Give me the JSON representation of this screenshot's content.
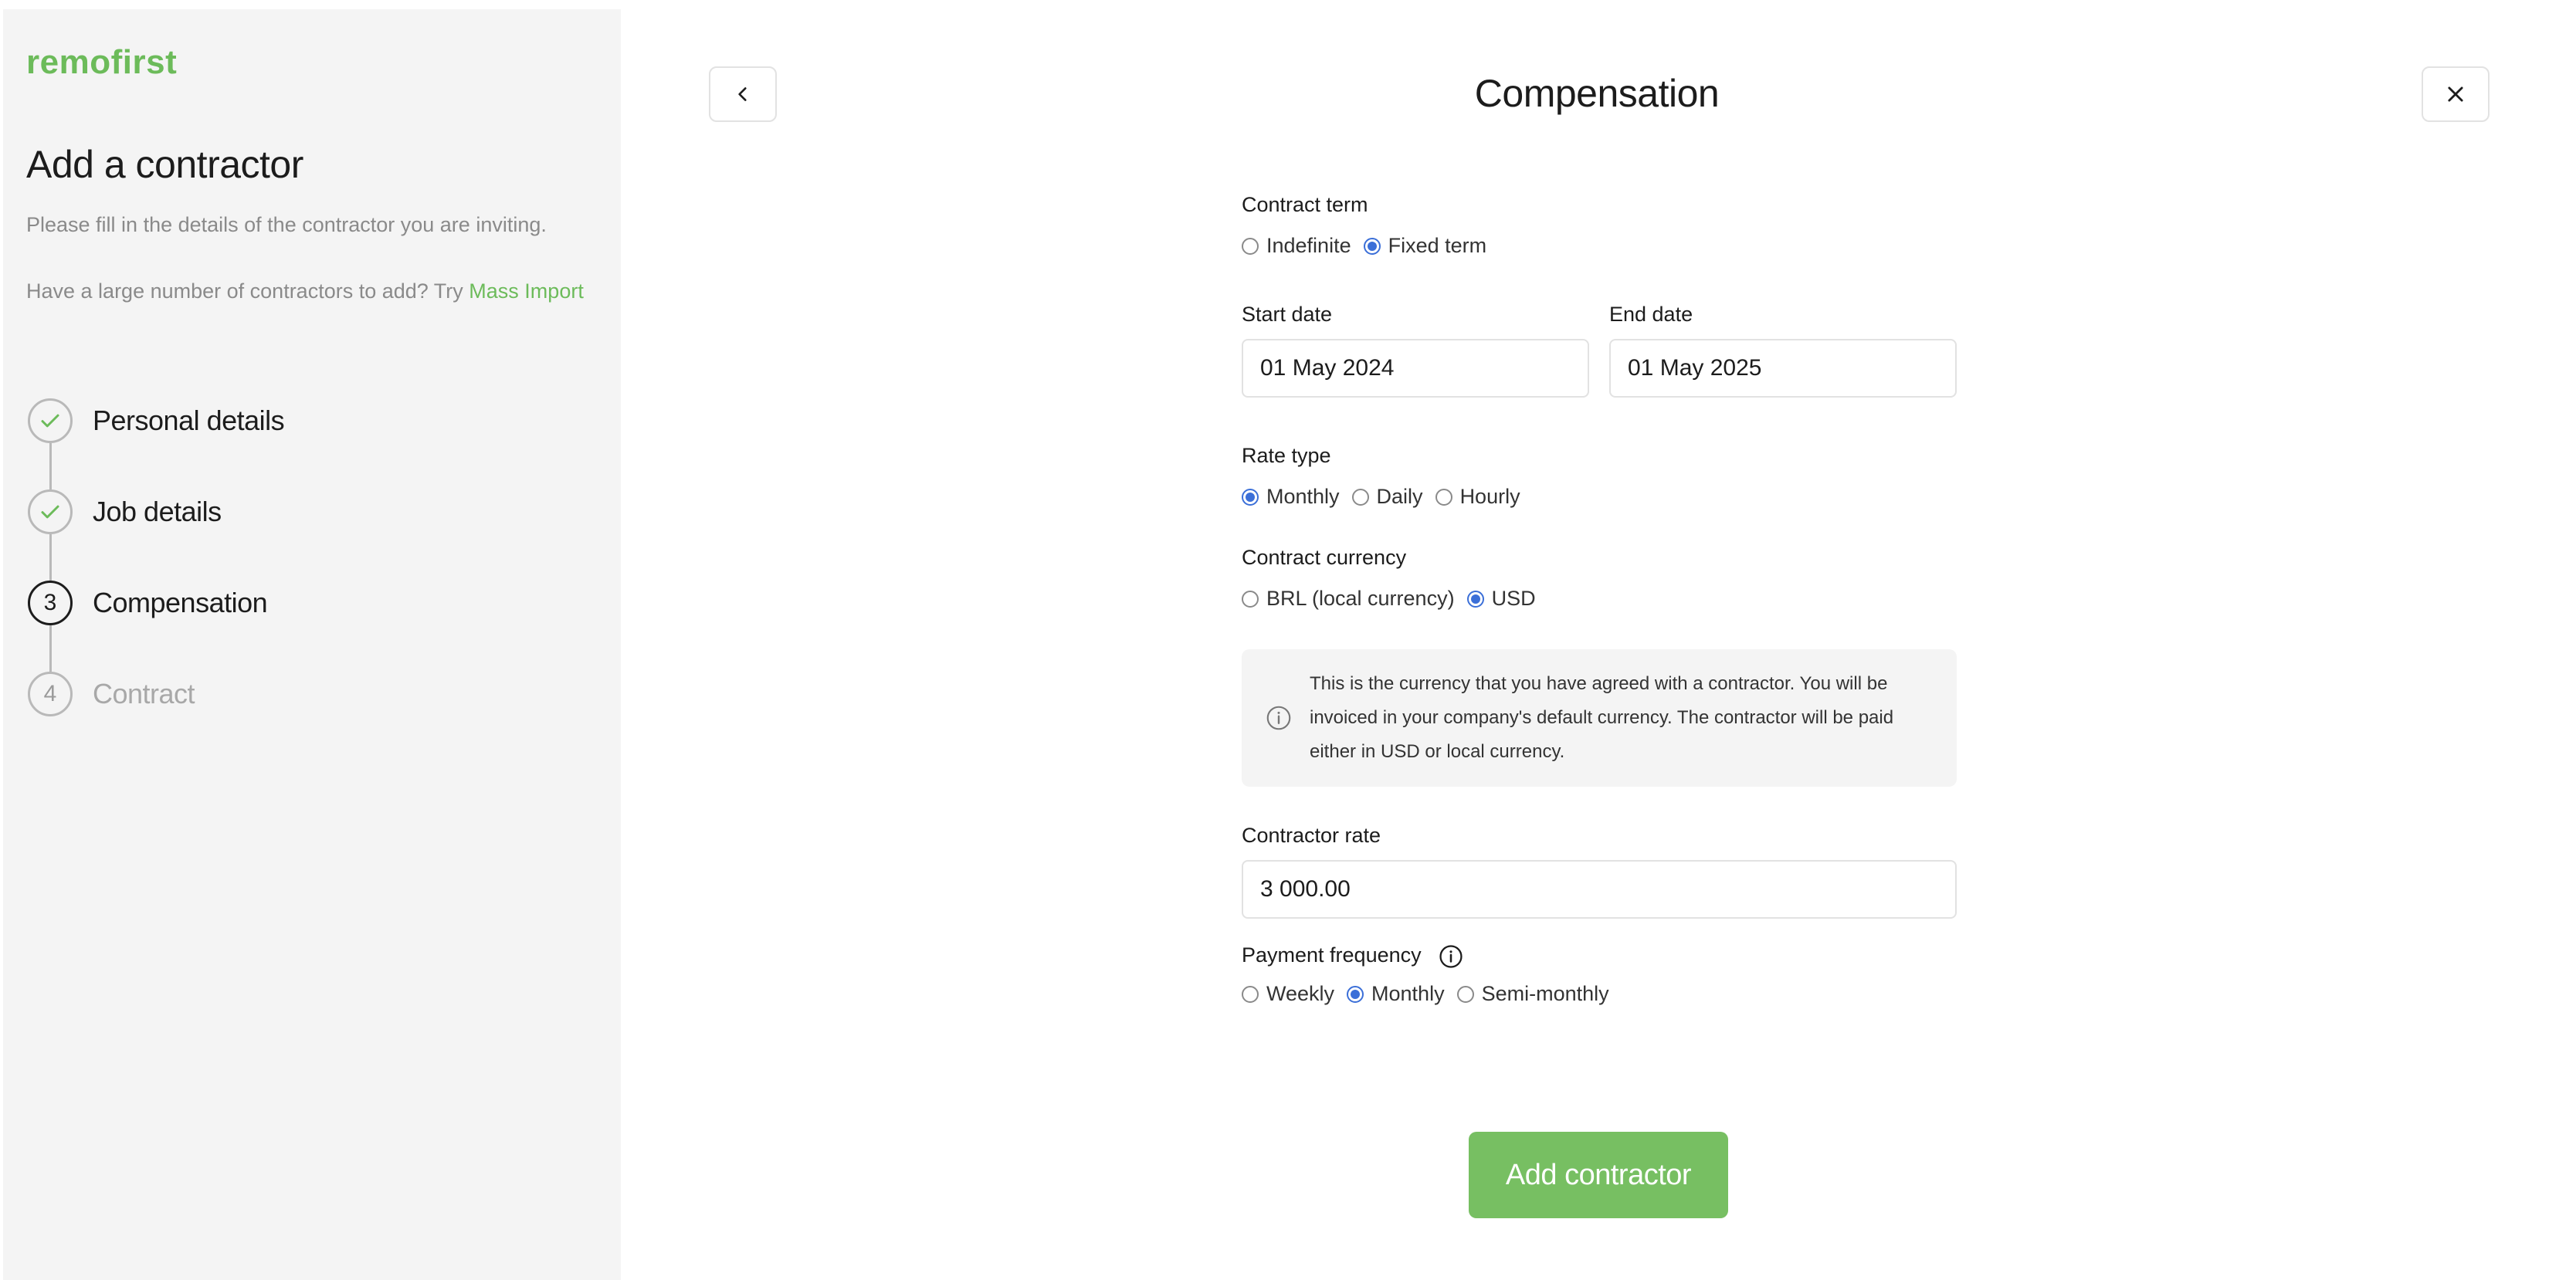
{
  "brand": {
    "logo_text": "remofirst",
    "accent": "#6cbb5a",
    "radio_color": "#3b6fd8"
  },
  "sidebar": {
    "title": "Add a contractor",
    "description": "Please fill in the details of the contractor you are inviting.",
    "mass_prompt": "Have a large number of contractors to add? Try ",
    "mass_link": "Mass Import",
    "steps": [
      {
        "number": "1",
        "label": "Personal details",
        "state": "done"
      },
      {
        "number": "2",
        "label": "Job details",
        "state": "done"
      },
      {
        "number": "3",
        "label": "Compensation",
        "state": "current"
      },
      {
        "number": "4",
        "label": "Contract",
        "state": "future"
      }
    ]
  },
  "header": {
    "title": "Compensation",
    "back_icon": "chevron-left-icon",
    "close_icon": "close-icon"
  },
  "form": {
    "contract_term": {
      "label": "Contract term",
      "options": [
        "Indefinite",
        "Fixed term"
      ],
      "selected": "Fixed term"
    },
    "start_date": {
      "label": "Start date",
      "value": "01 May 2024"
    },
    "end_date": {
      "label": "End date",
      "value": "01 May 2025"
    },
    "rate_type": {
      "label": "Rate type",
      "options": [
        "Monthly",
        "Daily",
        "Hourly"
      ],
      "selected": "Monthly"
    },
    "contract_currency": {
      "label": "Contract currency",
      "options": [
        "BRL (local currency)",
        "USD"
      ],
      "selected": "USD"
    },
    "info_text": "This is the currency that you have agreed with a contractor. You will be invoiced in your company's default currency. The contractor will be paid either in USD or local currency.",
    "contractor_rate": {
      "label": "Contractor rate",
      "value": "3 000.00"
    },
    "payment_frequency": {
      "label": "Payment frequency",
      "options": [
        "Weekly",
        "Monthly",
        "Semi-monthly"
      ],
      "selected": "Monthly"
    }
  },
  "actions": {
    "submit_label": "Add contractor"
  }
}
